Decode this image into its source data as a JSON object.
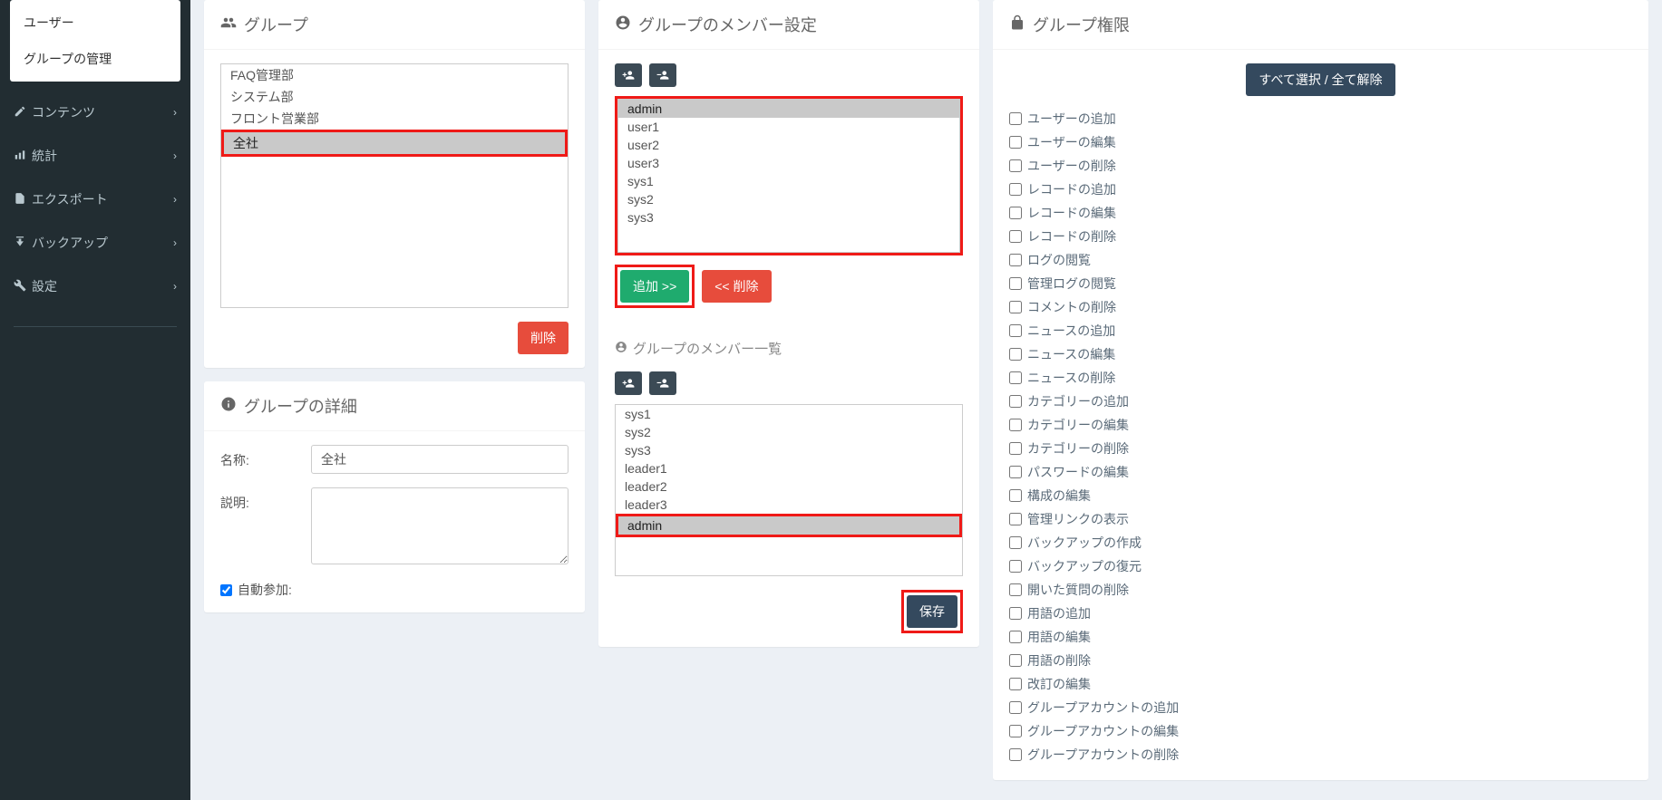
{
  "sidebar": {
    "box_items": [
      "ユーザー",
      "グループの管理"
    ],
    "menu": [
      {
        "label": "コンテンツ"
      },
      {
        "label": "統計"
      },
      {
        "label": "エクスポート"
      },
      {
        "label": "バックアップ"
      },
      {
        "label": "設定"
      }
    ]
  },
  "groups_panel": {
    "title": "グループ",
    "items": [
      "FAQ管理部",
      "システム部",
      "フロント営業部",
      "全社"
    ],
    "selected_index": 3,
    "delete_btn": "削除"
  },
  "details_panel": {
    "title": "グループの詳細",
    "name_label": "名称:",
    "name_value": "全社",
    "desc_label": "説明:",
    "desc_value": "",
    "auto_join_label": "自動参加:"
  },
  "members_panel": {
    "title": "グループのメンバー設定",
    "all_users": [
      "admin",
      "user1",
      "user2",
      "user3",
      "sys1",
      "sys2",
      "sys3"
    ],
    "selected_all_index": 0,
    "add_btn": "追加 >>",
    "remove_btn": "<< 削除",
    "list_title": "グループのメンバー一覧",
    "group_members": [
      "sys1",
      "sys2",
      "sys3",
      "leader1",
      "leader2",
      "leader3",
      "admin"
    ],
    "selected_member_index": 6,
    "save_btn": "保存"
  },
  "perm_panel": {
    "title": "グループ権限",
    "toggle_btn": "すべて選択 / 全て解除",
    "perms": [
      "ユーザーの追加",
      "ユーザーの編集",
      "ユーザーの削除",
      "レコードの追加",
      "レコードの編集",
      "レコードの削除",
      "ログの閲覧",
      "管理ログの閲覧",
      "コメントの削除",
      "ニュースの追加",
      "ニュースの編集",
      "ニュースの削除",
      "カテゴリーの追加",
      "カテゴリーの編集",
      "カテゴリーの削除",
      "パスワードの編集",
      "構成の編集",
      "管理リンクの表示",
      "バックアップの作成",
      "バックアップの復元",
      "開いた質問の削除",
      "用語の追加",
      "用語の編集",
      "用語の削除",
      "改訂の編集",
      "グループアカウントの追加",
      "グループアカウントの編集",
      "グループアカウントの削除"
    ]
  }
}
